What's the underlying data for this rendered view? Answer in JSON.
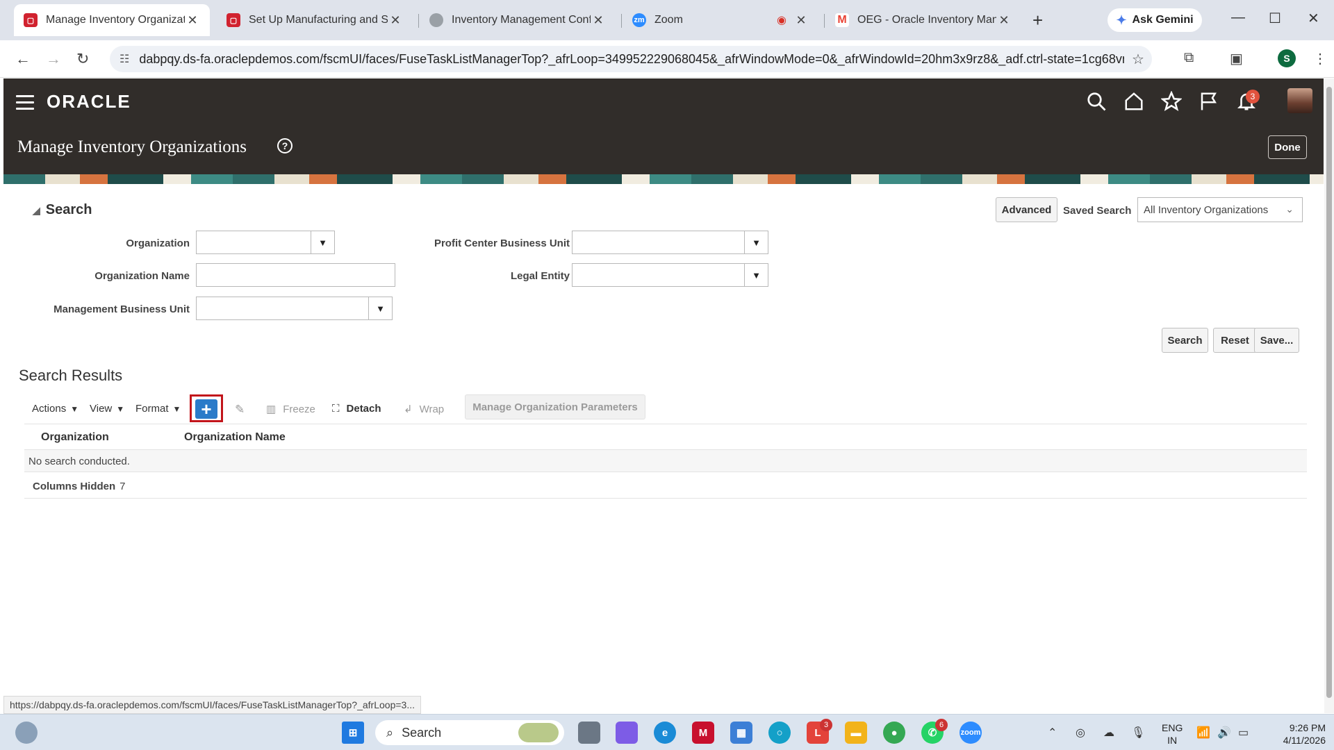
{
  "browser": {
    "tabs": [
      {
        "title": "Manage Inventory Organizatic",
        "favicon_color": "#d1222f",
        "active": true
      },
      {
        "title": "Set Up Manufacturing and Sup",
        "favicon_color": "#d1222f",
        "active": false
      },
      {
        "title": "Inventory Management Config",
        "favicon_color": "#888888",
        "active": false
      },
      {
        "title": "Zoom",
        "favicon_color": "#2d8cff",
        "active": false
      },
      {
        "title": "OEG - Oracle Inventory Manag",
        "favicon_color": "#ea4335",
        "active": false
      }
    ],
    "new_tab": "+",
    "gemini_label": "Ask Gemini",
    "url": "dabpqy.ds-fa.oraclepdemos.com/fscmUI/faces/FuseTaskListManagerTop?_afrLoop=349952229068045&_afrWindowMode=0&_afrWindowId=20hm3x9rz8&_adf.ctrl-state=1cg68vnsch_...",
    "profile_initial": "S",
    "status_url": "https://dabpqy.ds-fa.oraclepdemos.com/fscmUI/faces/FuseTaskListManagerTop?_afrLoop=3..."
  },
  "header": {
    "logo": "ORACLE",
    "page_title": "Manage Inventory Organizations",
    "notification_count": "3",
    "done_label": "Done"
  },
  "search": {
    "section_title": "Search",
    "advanced_label": "Advanced",
    "saved_search_label": "Saved Search",
    "saved_search_value": "All Inventory Organizations",
    "fields": {
      "organization": {
        "label": "Organization",
        "value": ""
      },
      "organization_name": {
        "label": "Organization Name",
        "value": ""
      },
      "management_bu": {
        "label": "Management Business Unit",
        "value": ""
      },
      "profit_center_bu": {
        "label": "Profit Center Business Unit",
        "value": ""
      },
      "legal_entity": {
        "label": "Legal Entity",
        "value": ""
      }
    },
    "buttons": {
      "search": "Search",
      "reset": "Reset",
      "save": "Save..."
    }
  },
  "results": {
    "title": "Search Results",
    "toolbar": {
      "actions": "Actions",
      "view": "View",
      "format": "Format",
      "freeze": "Freeze",
      "detach": "Detach",
      "wrap": "Wrap",
      "manage_params": "Manage Organization Parameters"
    },
    "columns": [
      "Organization",
      "Organization Name"
    ],
    "empty_message": "No search conducted.",
    "columns_hidden_label": "Columns Hidden",
    "columns_hidden_count": "7"
  },
  "taskbar": {
    "search_label": "Search",
    "lang_line1": "ENG",
    "lang_line2": "IN",
    "time": "9:26 PM",
    "date": "4/11/2026",
    "badge_l": "3",
    "badge_whatsapp": "6"
  },
  "colors": {
    "oracle_header": "#312d2a",
    "add_button": "#2a7bc9",
    "highlight_box": "#c2151b"
  }
}
